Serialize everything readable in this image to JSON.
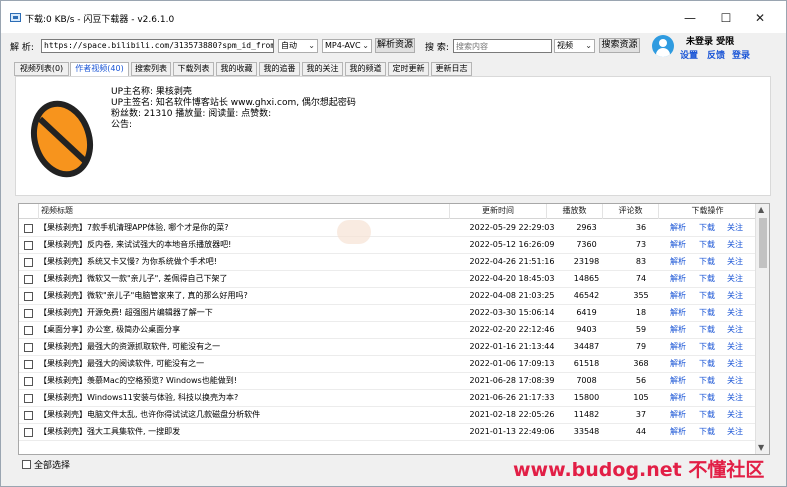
{
  "window": {
    "title": "下载:0 KB/s - 闪豆下载器 - v2.6.1.0",
    "minimize_glyph": "—",
    "maximize_glyph": "☐",
    "close_glyph": "✕"
  },
  "toolbar": {
    "parse_label": "解 析:",
    "url_value": "https://space.bilibili.com/313573880?spm_id_from=333",
    "mode_value": "自动",
    "format_value": "MP4-AVC",
    "parse_button": "解析资源",
    "search_label": "搜 索:",
    "search_placeholder": "搜索内容",
    "search_type_value": "视频",
    "search_button": "搜索资源"
  },
  "user": {
    "status": "未登录 受限",
    "settings_link": "设置",
    "feedback_link": "反馈",
    "login_link": "登录"
  },
  "tabs": [
    {
      "label": "视频列表(0)"
    },
    {
      "label": "作者视频(40)"
    },
    {
      "label": "搜索列表"
    },
    {
      "label": "下载列表"
    },
    {
      "label": "我的收藏"
    },
    {
      "label": "我的追番"
    },
    {
      "label": "我的关注"
    },
    {
      "label": "我的频道"
    },
    {
      "label": "定时更新"
    },
    {
      "label": "更新日志"
    }
  ],
  "profile": {
    "up_name": "UP主名称: 果核剥壳",
    "up_signature": "UP主签名: 知名软件博客站长 www.ghxi.com, 偶尔想起密码",
    "stats": "粉丝数: 21310   播放量:    阅读量:    点赞数:",
    "notice": "公告:"
  },
  "table": {
    "headers": {
      "title": "视频标题",
      "time": "更新时间",
      "plays": "播放数",
      "comments": "评论数",
      "actions": "下载操作"
    },
    "action_labels": {
      "parse": "解析",
      "download": "下载",
      "follow": "关注"
    },
    "rows": [
      {
        "title": "【果核剥壳】7款手机清理APP体验, 哪个才是你的菜?",
        "time": "2022-05-29 22:29:03",
        "plays": "2963",
        "comments": "36"
      },
      {
        "title": "【果核剥壳】反内卷, 来试试强大的本地音乐播放器吧!",
        "time": "2022-05-12 16:26:09",
        "plays": "7360",
        "comments": "73"
      },
      {
        "title": "【果核剥壳】系统又卡又慢? 为你系统做个手术吧!",
        "time": "2022-04-26 21:51:16",
        "plays": "23198",
        "comments": "83"
      },
      {
        "title": "【果核剥壳】微软又一款\"亲儿子\", 差佩得自己下架了",
        "time": "2022-04-20 18:45:03",
        "plays": "14865",
        "comments": "74"
      },
      {
        "title": "【果核剥壳】微软\"亲儿子\"电脑管家来了, 真的那么好用吗?",
        "time": "2022-04-08 21:03:25",
        "plays": "46542",
        "comments": "355"
      },
      {
        "title": "【果核剥壳】开源免费! 超强图片编辑器了解一下",
        "time": "2022-03-30 15:06:14",
        "plays": "6419",
        "comments": "18"
      },
      {
        "title": "【桌面分享】办公室, 极简办公桌面分享",
        "time": "2022-02-20 22:12:46",
        "plays": "9403",
        "comments": "59"
      },
      {
        "title": "【果核剥壳】最强大的资源抓取软件, 可能没有之一",
        "time": "2022-01-16 21:13:44",
        "plays": "34487",
        "comments": "79"
      },
      {
        "title": "【果核剥壳】最强大的阅读软件, 可能没有之一",
        "time": "2022-01-06 17:09:13",
        "plays": "61518",
        "comments": "368"
      },
      {
        "title": "【果核剥壳】羡慕Mac的空格预览? Windows也能做到!",
        "time": "2021-06-28 17:08:39",
        "plays": "7008",
        "comments": "56"
      },
      {
        "title": "【果核剥壳】Windows11安装与体验, 科技以换壳为本?",
        "time": "2021-06-26 21:17:33",
        "plays": "15800",
        "comments": "105"
      },
      {
        "title": "【果核剥壳】电脑文件太乱, 也许你得试试这几款磁盘分析软件",
        "time": "2021-02-18 22:05:26",
        "plays": "11482",
        "comments": "37"
      },
      {
        "title": "【果核剥壳】强大工具集软件, 一搜即发",
        "time": "2021-01-13 22:49:06",
        "plays": "33548",
        "comments": "44"
      }
    ]
  },
  "footer": {
    "select_all": "全部选择"
  },
  "watermark": "www.budog.net 不懂社区",
  "colors": {
    "link_blue": "#1a55d6",
    "watermark_red": "#e21f46",
    "avatar_blue": "#2f9be0",
    "logo_orange": "#f7941d"
  },
  "icons": {
    "app": "app-icon",
    "avatar": "user-avatar-icon",
    "logo": "nut-logo-icon"
  }
}
